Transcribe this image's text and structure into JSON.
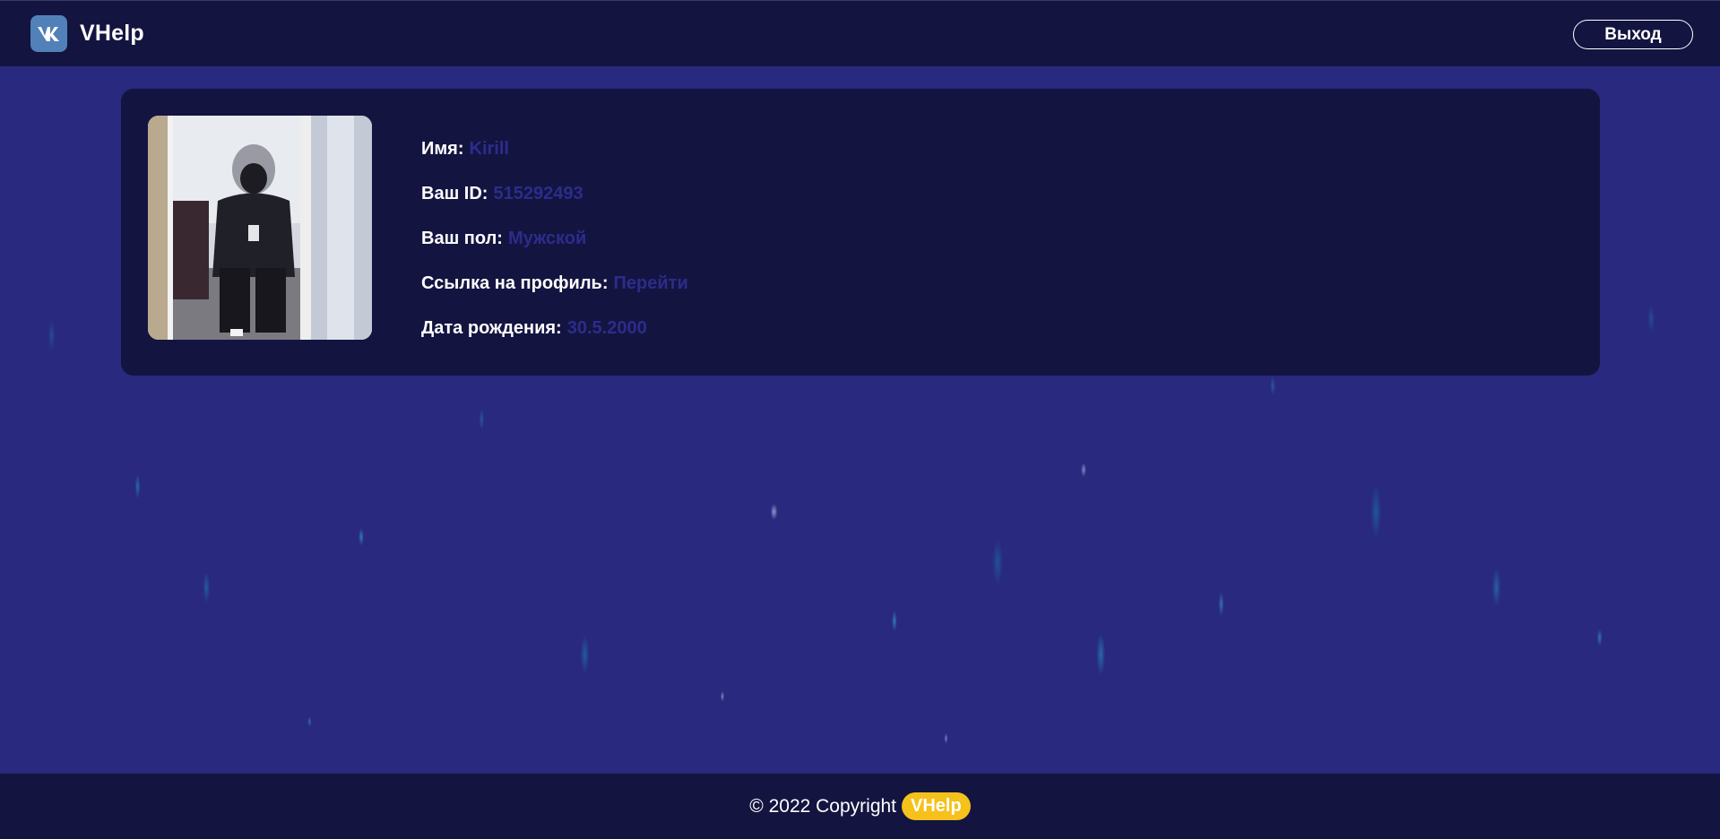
{
  "header": {
    "brand_name": "VHelp",
    "logo_icon": "vk-logo-icon",
    "logout_label": "Выход"
  },
  "profile": {
    "photo": "user-photo",
    "name_label": "Имя:",
    "name_value": "Kirill",
    "id_label": "Ваш ID:",
    "id_value": "515292493",
    "gender_label": "Ваш пол:",
    "gender_value": "Мужской",
    "link_label": "Ссылка на профиль:",
    "link_value": "Перейти",
    "birthday_label": "Дата рождения:",
    "birthday_value": "30.5.2000"
  },
  "footer": {
    "copyright": "© 2022 Copyright",
    "brand": "VHelp"
  },
  "colors": {
    "background": "#28297f",
    "panel": "#141441",
    "value_text": "#2c2c8c",
    "vk_blue": "#5181b8",
    "footer_badge": "#f5c11a"
  }
}
